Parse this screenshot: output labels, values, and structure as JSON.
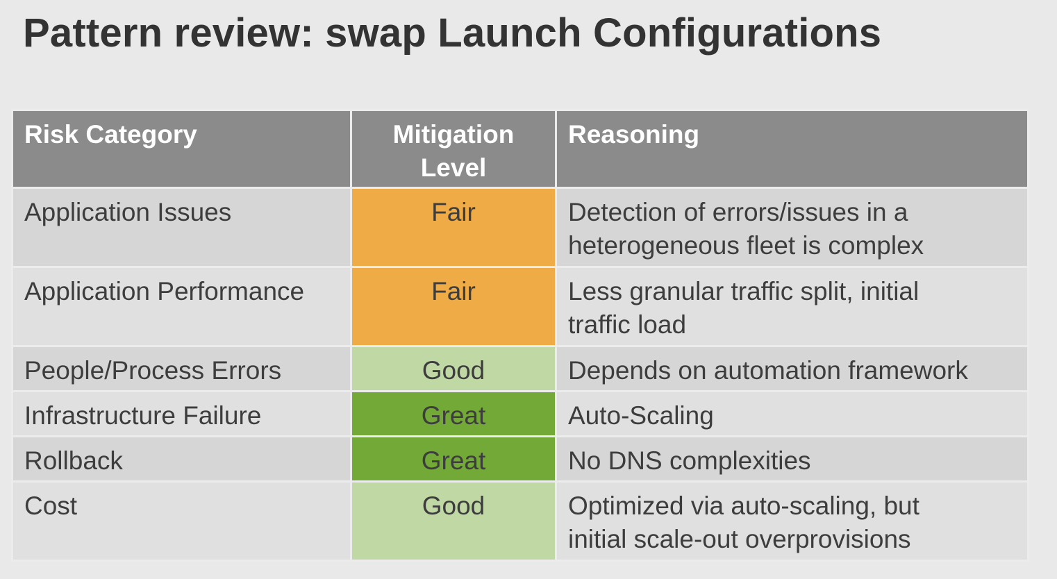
{
  "slide": {
    "title": "Pattern review: swap Launch Configurations"
  },
  "table": {
    "headers": {
      "risk_category": "Risk Category",
      "mitigation_level_line1": "Mitigation",
      "mitigation_level_line2": "Level",
      "reasoning": "Reasoning"
    },
    "rows": [
      {
        "risk": "Application Issues",
        "level": "Fair",
        "reasoning_line1": "Detection of errors/issues in a",
        "reasoning_line2": "heterogeneous fleet is complex"
      },
      {
        "risk": "Application Performance",
        "level": "Fair",
        "reasoning_line1": "Less granular traffic split, initial",
        "reasoning_line2": "traffic load"
      },
      {
        "risk": "People/Process Errors",
        "level": "Good",
        "reasoning_line1": "Depends on automation framework"
      },
      {
        "risk": "Infrastructure Failure",
        "level": "Great",
        "reasoning_line1": "Auto-Scaling"
      },
      {
        "risk": "Rollback",
        "level": "Great",
        "reasoning_line1": "No DNS complexities"
      },
      {
        "risk": "Cost",
        "level": "Good",
        "reasoning_line1": "Optimized via auto-scaling, but",
        "reasoning_line2": "initial scale-out overprovisions"
      }
    ]
  },
  "colors": {
    "header_bg": "#8b8b8b",
    "fair": "#efab45",
    "good": "#bfd8a4",
    "great": "#72a937"
  }
}
